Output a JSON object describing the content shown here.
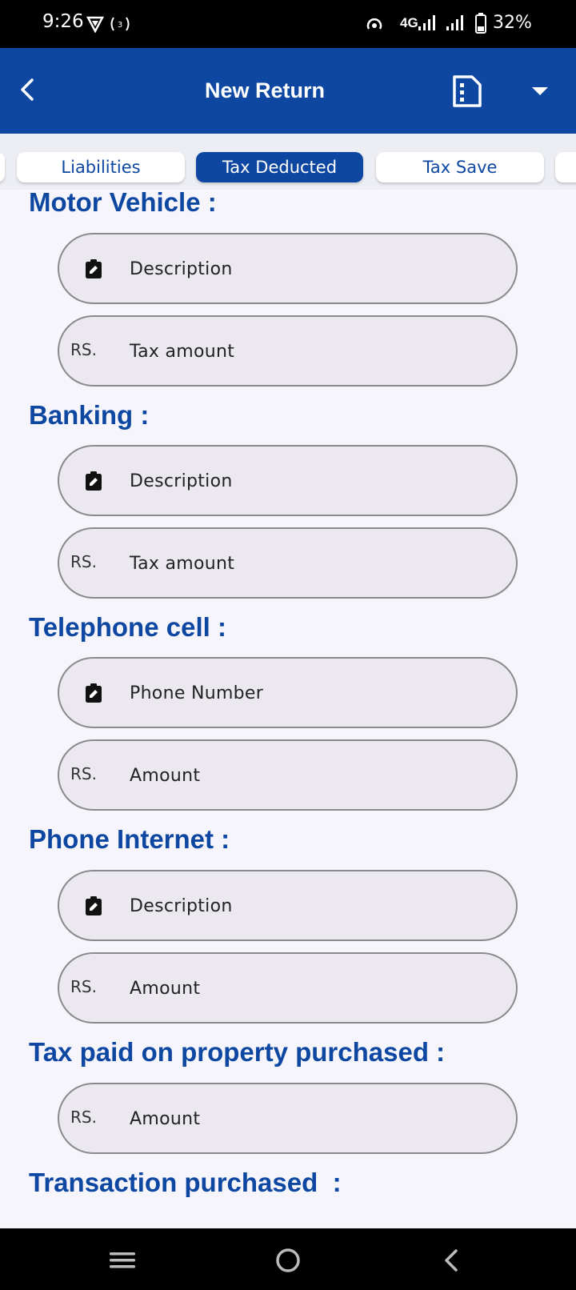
{
  "status_bar": {
    "time": "9:26",
    "network": "4G",
    "battery": "32%"
  },
  "app_bar": {
    "title": "New Return",
    "icons": [
      "back-arrow-icon",
      "document-icon",
      "dropdown-arrow-icon"
    ]
  },
  "tabs": [
    {
      "label": "Liabilities",
      "active": false
    },
    {
      "label": "Tax Deducted",
      "active": true
    },
    {
      "label": "Tax Save",
      "active": false
    }
  ],
  "sections": [
    {
      "title": "Motor Vehicle :",
      "fields": [
        {
          "icon": "edit-clipboard-icon",
          "placeholder": "Description"
        },
        {
          "prefix": "RS.",
          "placeholder": "Tax amount"
        }
      ]
    },
    {
      "title": "Banking :",
      "fields": [
        {
          "icon": "edit-clipboard-icon",
          "placeholder": "Description"
        },
        {
          "prefix": "RS.",
          "placeholder": "Tax amount"
        }
      ]
    },
    {
      "title": "Telephone cell :",
      "fields": [
        {
          "icon": "edit-clipboard-icon",
          "placeholder": "Phone Number"
        },
        {
          "prefix": "RS.",
          "placeholder": "Amount"
        }
      ]
    },
    {
      "title": "Phone Internet :",
      "fields": [
        {
          "icon": "edit-clipboard-icon",
          "placeholder": "Description"
        },
        {
          "prefix": "RS.",
          "placeholder": "Amount"
        }
      ]
    },
    {
      "title": "Tax paid on property purchased :",
      "fields": [
        {
          "prefix": "RS.",
          "placeholder": "Amount"
        }
      ]
    },
    {
      "title": "Transaction purchased  :",
      "fields": []
    }
  ],
  "colors": {
    "primary": "#0d47a1",
    "field_bg": "#ebe9ef",
    "field_border": "#8a8a8e",
    "page_bg": "#f5f5fb"
  }
}
